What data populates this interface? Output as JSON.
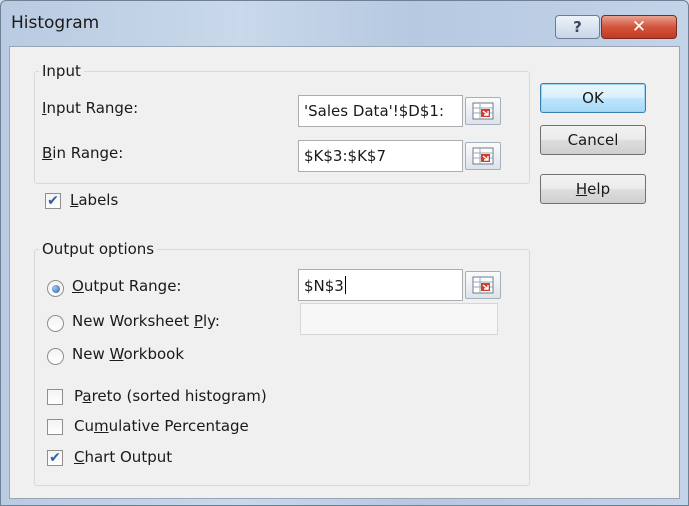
{
  "window": {
    "title": "Histogram",
    "help_glyph": "?",
    "close_glyph": "✕"
  },
  "input_group": {
    "legend": "Input",
    "input_range": {
      "label_pre": "",
      "label_key": "I",
      "label_post": "nput Range:",
      "value": "'Sales Data'!$D$1:"
    },
    "bin_range": {
      "label_pre": "",
      "label_key": "B",
      "label_post": "in Range:",
      "value": "$K$3:$K$7"
    },
    "ref_icon": "range-selector-icon"
  },
  "labels_checkbox": {
    "checked": true,
    "label_key": "L",
    "label_post": "abels",
    "check_glyph": "✔"
  },
  "output_group": {
    "legend": "Output options",
    "output_range": {
      "selected": true,
      "label_key": "O",
      "label_post": "utput Range:",
      "value": "$N$3"
    },
    "new_worksheet": {
      "selected": false,
      "label_pre": "New Worksheet ",
      "label_key": "P",
      "label_post": "ly:",
      "value": ""
    },
    "new_workbook": {
      "selected": false,
      "label_pre": "New ",
      "label_key": "W",
      "label_post": "orkbook"
    },
    "pareto": {
      "checked": false,
      "label_pre": "P",
      "label_key": "a",
      "label_post": "reto (sorted histogram)"
    },
    "cumulative": {
      "checked": false,
      "label_pre": "Cu",
      "label_key": "m",
      "label_post": "ulative Percentage"
    },
    "chart_output": {
      "checked": true,
      "label_pre": "",
      "label_key": "C",
      "label_post": "hart Output",
      "check_glyph": "✔"
    }
  },
  "buttons": {
    "ok": "OK",
    "cancel": "Cancel",
    "help_key": "H",
    "help_post": "elp"
  }
}
